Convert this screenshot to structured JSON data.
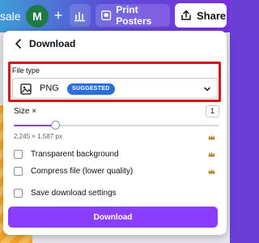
{
  "topbar": {
    "scale_fragment": "sale",
    "avatar_initial": "M",
    "print_label": "Print Posters",
    "share_label": "Share"
  },
  "panel": {
    "title": "Download",
    "file_type": {
      "label": "File type",
      "value": "PNG",
      "badge": "SUGGESTED"
    },
    "size": {
      "label": "Size ×",
      "multiplier": "1",
      "slider_fraction": 0.2,
      "dimensions": "2,245 × 1,587 px"
    },
    "options": [
      {
        "label": "Transparent background",
        "checked": false,
        "premium": true
      },
      {
        "label": "Compress file (lower quality)",
        "checked": false,
        "premium": true
      },
      {
        "label": "Save download settings",
        "checked": false,
        "premium": false
      }
    ],
    "download_label": "Download"
  },
  "colors": {
    "accent": "#8b3dff",
    "badge": "#2b6ddb",
    "highlight": "#d21515",
    "avatar": "#1f7a45"
  }
}
